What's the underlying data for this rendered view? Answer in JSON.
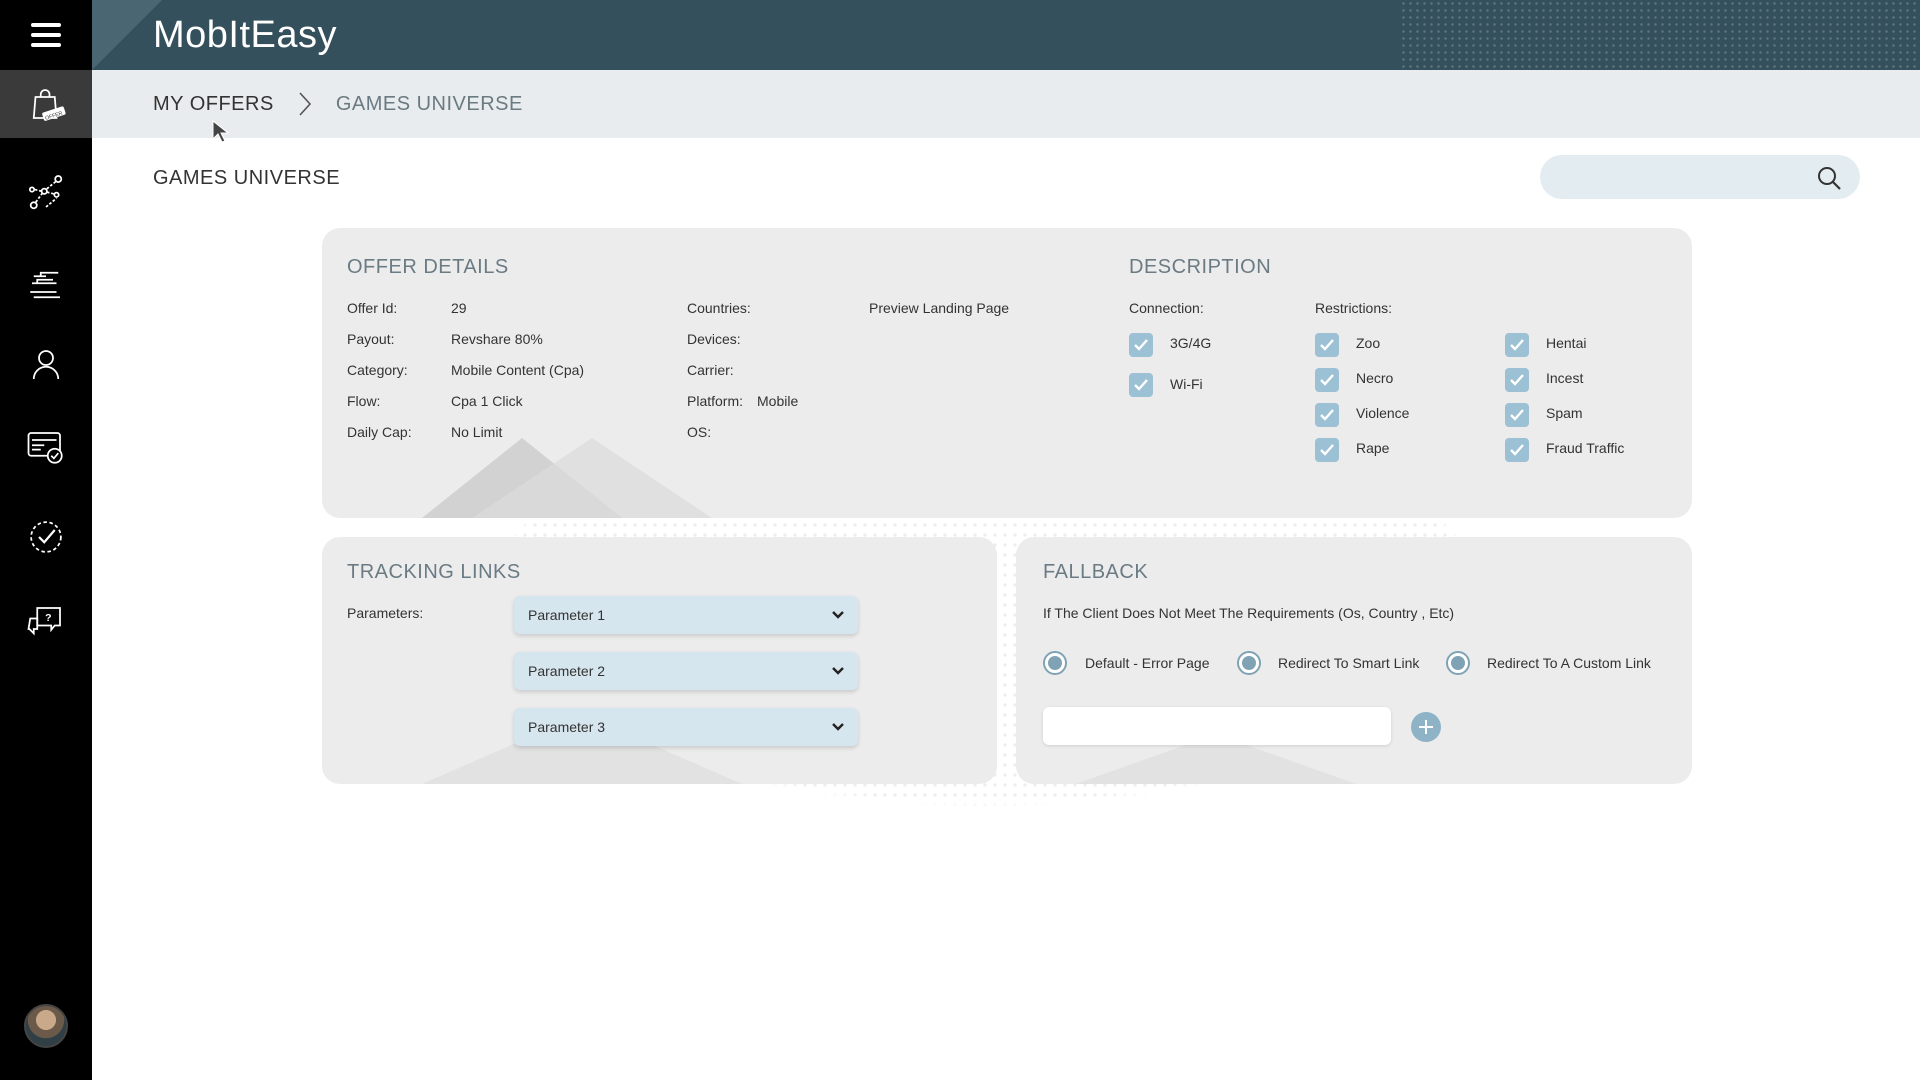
{
  "app": {
    "title": "MobItEasy"
  },
  "breadcrumb": {
    "root": "MY OFFERS",
    "current": "GAMES UNIVERSE"
  },
  "page": {
    "title": "GAMES UNIVERSE"
  },
  "search": {
    "placeholder": ""
  },
  "offer_details": {
    "title": "OFFER DETAILS",
    "offer_id_label": "Offer Id:",
    "offer_id": "29",
    "payout_label": "Payout:",
    "payout": "Revshare 80%",
    "category_label": "Category:",
    "category": "Mobile Content (Cpa)",
    "flow_label": "Flow:",
    "flow": "Cpa 1 Click",
    "daily_cap_label": "Daily Cap:",
    "daily_cap": "No Limit",
    "countries_label": "Countries:",
    "preview_link": "Preview Landing Page",
    "devices_label": "Devices:",
    "carrier_label": "Carrier:",
    "platform_label": "Platform:",
    "platform": "Mobile",
    "os_label": "OS:"
  },
  "description": {
    "title": "DESCRIPTION",
    "connection_label": "Connection:",
    "connections": [
      "3G/4G",
      "Wi-Fi"
    ],
    "restrictions_label": "Restrictions:",
    "restrictions_col1": [
      "Zoo",
      "Necro",
      "Violence",
      "Rape"
    ],
    "restrictions_col2": [
      "Hentai",
      "Incest",
      "Spam",
      "Fraud Traffic"
    ]
  },
  "tracking": {
    "title": "TRACKING LINKS",
    "parameters_label": "Parameters:",
    "parameters": [
      "Parameter 1",
      "Parameter 2",
      "Parameter 3"
    ]
  },
  "fallback": {
    "title": "FALLBACK",
    "description": "If The Client Does Not Meet The Requirements (Os, Country , Etc)",
    "options": [
      "Default - Error Page",
      "Redirect To Smart Link",
      "Redirect To A Custom Link"
    ],
    "custom_link_value": ""
  },
  "colors": {
    "sidebar": "#000000",
    "header": "#34505c",
    "breadcrumb_bg": "#e8ecee",
    "card_bg": "#ececec",
    "accent": "#9cc1d4"
  },
  "icons": {
    "sidebar": [
      "menu-icon",
      "offer-bag-icon",
      "network-icon",
      "reports-icon",
      "user-icon",
      "billing-icon",
      "approval-icon",
      "support-chat-icon"
    ]
  }
}
